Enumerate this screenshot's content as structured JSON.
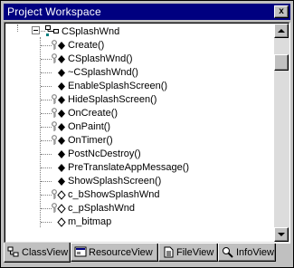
{
  "window": {
    "title": "Project Workspace",
    "close_glyph": "x"
  },
  "tree": {
    "class_name": "CSplashWnd",
    "members": [
      {
        "label": "Create()",
        "icon": "public-static-method-icon"
      },
      {
        "label": "CSplashWnd()",
        "icon": "public-static-method-icon"
      },
      {
        "label": "~CSplashWnd()",
        "icon": "public-method-icon"
      },
      {
        "label": "EnableSplashScreen()",
        "icon": "public-method-icon"
      },
      {
        "label": "HideSplashScreen()",
        "icon": "public-static-method-icon"
      },
      {
        "label": "OnCreate()",
        "icon": "public-static-method-icon"
      },
      {
        "label": "OnPaint()",
        "icon": "public-static-method-icon"
      },
      {
        "label": "OnTimer()",
        "icon": "public-static-method-icon"
      },
      {
        "label": "PostNcDestroy()",
        "icon": "public-method-icon"
      },
      {
        "label": "PreTranslateAppMessage()",
        "icon": "public-method-icon"
      },
      {
        "label": "ShowSplashScreen()",
        "icon": "public-method-icon"
      },
      {
        "label": "c_bShowSplashWnd",
        "icon": "protected-member-variable-icon"
      },
      {
        "label": "c_pSplashWnd",
        "icon": "protected-member-variable-icon"
      },
      {
        "label": "m_bitmap",
        "icon": "member-variable-icon"
      }
    ]
  },
  "tabs": [
    {
      "label": "ClassView",
      "icon": "classview-icon",
      "active": true
    },
    {
      "label": "ResourceView",
      "icon": "resourceview-icon",
      "active": false
    },
    {
      "label": "FileView",
      "icon": "fileview-icon",
      "active": false
    },
    {
      "label": "InfoView",
      "icon": "infoview-icon",
      "active": false
    }
  ],
  "colors": {
    "titlebar": "#000080",
    "method_magenta": "#800080",
    "variable_cyan": "#008080",
    "key_yellow": "#c0c000"
  }
}
